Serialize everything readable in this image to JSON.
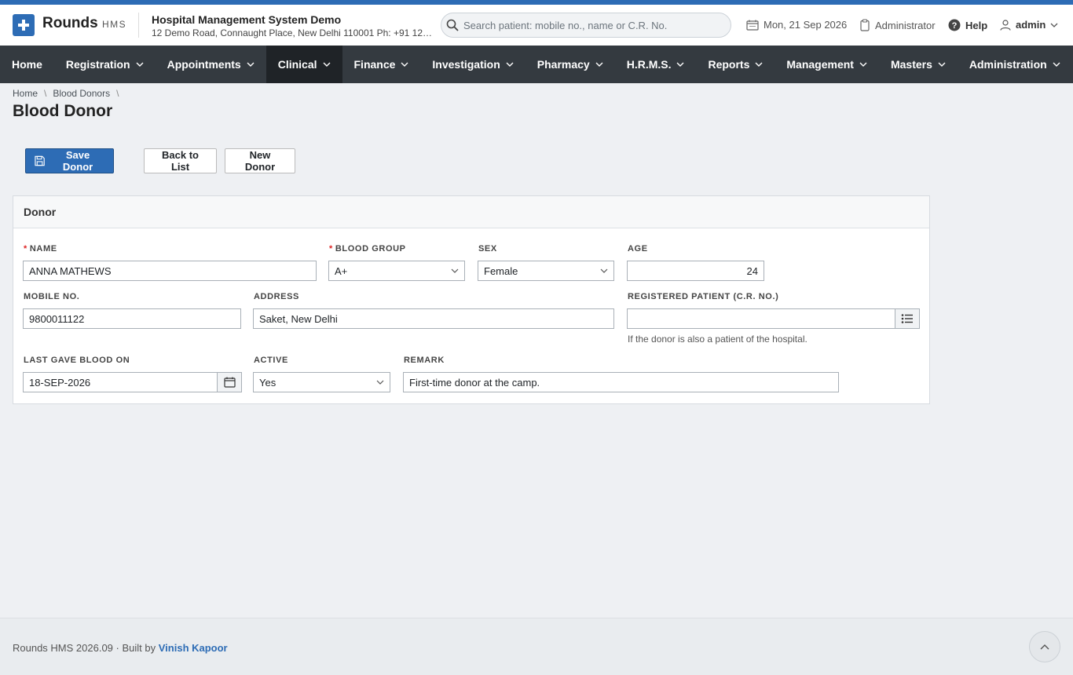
{
  "header": {
    "brand": "Rounds",
    "brand_sub": "HMS",
    "hospital_name": "Hospital Management System Demo",
    "hospital_address": "12 Demo Road, Connaught Place, New Delhi 110001 Ph: +91 123...",
    "search_placeholder": "Search patient: mobile no., name or C.R. No.",
    "date": "Mon, 21 Sep 2026",
    "role": "Administrator",
    "help": "Help",
    "user": "admin"
  },
  "nav": [
    "Home",
    "Registration",
    "Appointments",
    "Clinical",
    "Finance",
    "Investigation",
    "Pharmacy",
    "H.R.M.S.",
    "Reports",
    "Management",
    "Masters",
    "Administration"
  ],
  "breadcrumb": [
    "Home",
    "Blood Donors"
  ],
  "page_title": "Blood Donor",
  "toolbar": {
    "save": "Save Donor",
    "back": "Back to List",
    "new": "New Donor"
  },
  "card": {
    "title": "Donor",
    "fields": {
      "name_label": "NAME",
      "name_value": "ANNA MATHEWS",
      "blood_group_label": "BLOOD GROUP",
      "blood_group_value": "A+",
      "sex_label": "SEX",
      "sex_value": "Female",
      "age_label": "AGE",
      "age_value": "24",
      "mobile_label": "MOBILE NO.",
      "mobile_value": "9800011122",
      "address_label": "ADDRESS",
      "address_value": "Saket, New Delhi",
      "patient_label": "REGISTERED PATIENT (C.R. NO.)",
      "patient_value": "",
      "patient_hint": "If the donor is also a patient of the hospital.",
      "last_gave_label": "LAST GAVE BLOOD ON",
      "last_gave_value": "18-SEP-2026",
      "active_label": "ACTIVE",
      "active_value": "Yes",
      "remark_label": "REMARK",
      "remark_value": "First-time donor at the camp."
    }
  },
  "footer": {
    "text": "Rounds HMS 2026.09 · Built by",
    "author": "Vinish Kapoor"
  }
}
